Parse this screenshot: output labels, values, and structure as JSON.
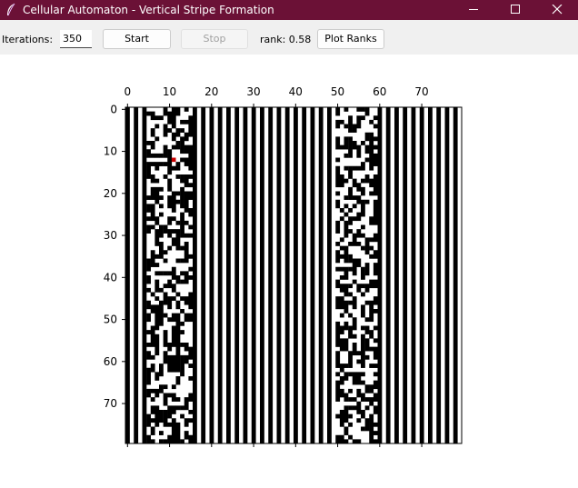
{
  "window": {
    "title": "Cellular Automaton - Vertical Stripe Formation"
  },
  "toolbar": {
    "iterations_label": "Iterations:",
    "iterations_value": "350",
    "start_label": "Start",
    "stop_label": "Stop",
    "rank_text": "rank: 0.58",
    "plot_ranks_label": "Plot Ranks"
  },
  "grid": {
    "rows": 80,
    "cols": 80,
    "x_ticks": [
      "0",
      "10",
      "20",
      "30",
      "40",
      "50",
      "60",
      "70"
    ],
    "y_ticks": [
      "0",
      "10",
      "20",
      "30",
      "40",
      "50",
      "60",
      "70"
    ],
    "x_tick_values": [
      0,
      10,
      20,
      30,
      40,
      50,
      60,
      70
    ],
    "y_tick_values": [
      0,
      10,
      20,
      30,
      40,
      50,
      60,
      70
    ],
    "pattern": "alternating vertical black/white column stripes with two disordered bands near columns 5-15 and 50-59",
    "defect_bands": [
      [
        5,
        15
      ],
      [
        50,
        59
      ]
    ],
    "marker": {
      "col": 11,
      "row": 12,
      "color": "#cc0000"
    }
  },
  "colors": {
    "titlebar": "#6b1136",
    "toolbar": "#f0f0f0",
    "black": "#000000",
    "white": "#ffffff"
  }
}
